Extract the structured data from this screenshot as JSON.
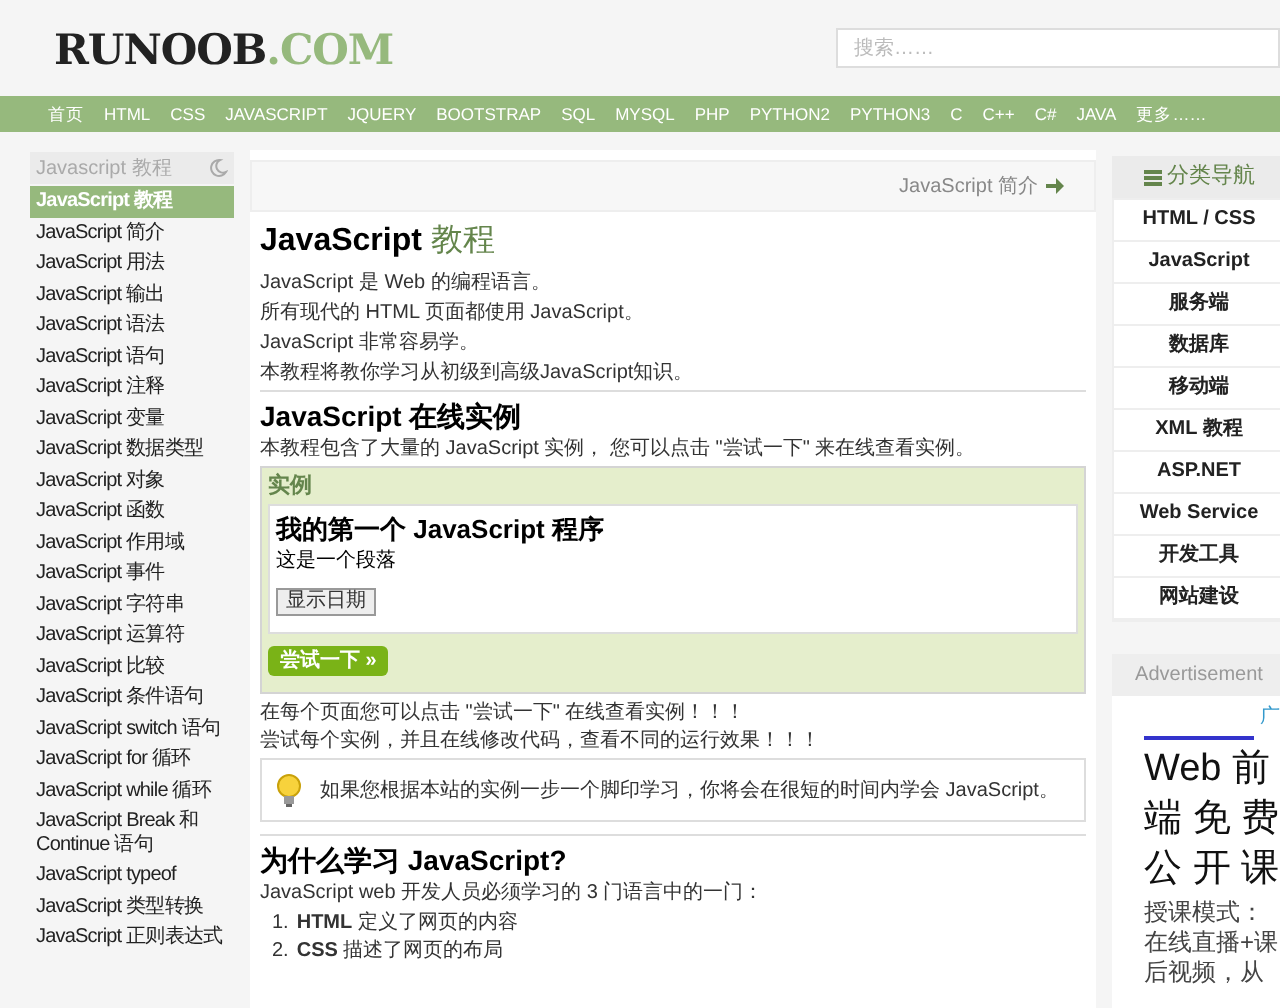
{
  "logo": {
    "name": "RUNOOB",
    "suffix": ".COM"
  },
  "search": {
    "placeholder": "搜索……"
  },
  "nav": [
    "首页",
    "HTML",
    "CSS",
    "JAVASCRIPT",
    "JQUERY",
    "BOOTSTRAP",
    "SQL",
    "MYSQL",
    "PHP",
    "PYTHON2",
    "PYTHON3",
    "C",
    "C++",
    "C#",
    "JAVA",
    "更多……"
  ],
  "sidebar": {
    "title": "Javascript 教程",
    "items": [
      {
        "label": "JavaScript 教程",
        "selected": true
      },
      {
        "label": "JavaScript 简介",
        "selected": false
      },
      {
        "label": "JavaScript 用法",
        "selected": false
      },
      {
        "label": "JavaScript 输出",
        "selected": false
      },
      {
        "label": "JavaScript 语法",
        "selected": false
      },
      {
        "label": "JavaScript 语句",
        "selected": false
      },
      {
        "label": "JavaScript 注释",
        "selected": false
      },
      {
        "label": "JavaScript 变量",
        "selected": false
      },
      {
        "label": "JavaScript 数据类型",
        "selected": false
      },
      {
        "label": "JavaScript 对象",
        "selected": false
      },
      {
        "label": "JavaScript 函数",
        "selected": false
      },
      {
        "label": "JavaScript 作用域",
        "selected": false
      },
      {
        "label": "JavaScript 事件",
        "selected": false
      },
      {
        "label": "JavaScript 字符串",
        "selected": false
      },
      {
        "label": "JavaScript 运算符",
        "selected": false
      },
      {
        "label": "JavaScript 比较",
        "selected": false
      },
      {
        "label": "JavaScript 条件语句",
        "selected": false
      },
      {
        "label": "JavaScript switch 语句",
        "selected": false
      },
      {
        "label": "JavaScript for 循环",
        "selected": false
      },
      {
        "label": "JavaScript while 循环",
        "selected": false
      },
      {
        "label": "JavaScript Break 和 Continue 语句",
        "selected": false
      },
      {
        "label": "JavaScript typeof",
        "selected": false
      },
      {
        "label": "JavaScript 类型转换",
        "selected": false
      },
      {
        "label": "JavaScript 正则表达式",
        "selected": false
      }
    ]
  },
  "main": {
    "next_link": "JavaScript 简介",
    "title": {
      "text": "JavaScript",
      "highlight": "教程"
    },
    "intro": [
      "JavaScript 是 Web 的编程语言。",
      "所有现代的 HTML 页面都使用 JavaScript。",
      "JavaScript 非常容易学。",
      "本教程将教你学习从初级到高级JavaScript知识。"
    ],
    "section1": {
      "heading": "JavaScript 在线实例",
      "text": "本教程包含了大量的 JavaScript 实例， 您可以点击 \"尝试一下\" 来在线查看实例。"
    },
    "example": {
      "label": "实例",
      "heading": "我的第一个 JavaScript 程序",
      "paragraph": "这是一个段落",
      "button": "显示日期",
      "try_button": "尝试一下 »"
    },
    "notes": [
      "在每个页面您可以点击 \"尝试一下\" 在线查看实例！！！",
      "尝试每个实例，并且在线修改代码，查看不同的运行效果！！！"
    ],
    "tip": "如果您根据本站的实例一步一个脚印学习，你将会在很短的时间内学会 JavaScript。",
    "section2": {
      "heading": "为什么学习 JavaScript?",
      "text": "JavaScript web 开发人员必须学习的 3 门语言中的一门：",
      "list": [
        {
          "number": "1.",
          "text": "**HTML** 定义了网页的内容"
        },
        {
          "number": "2.",
          "text": "**CSS** 描述了网页的布局"
        }
      ]
    }
  },
  "category_nav": {
    "title": "分类导航",
    "items": [
      "HTML / CSS",
      "JavaScript",
      "服务端",
      "数据库",
      "移动端",
      "XML 教程",
      "ASP.NET",
      "Web Service",
      "开发工具",
      "网站建设"
    ]
  },
  "advertisement": {
    "label": "Advertisement",
    "tag": "广",
    "headline": [
      "Web 前",
      "端 免 费",
      "公 开 课"
    ],
    "body": [
      "授课模式：",
      "在线直播+课",
      "后视频，从"
    ]
  }
}
